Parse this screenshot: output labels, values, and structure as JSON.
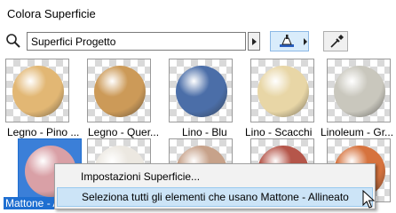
{
  "window": {
    "title": "Colora Superficie"
  },
  "toolbar": {
    "search_value": "Superfici Progetto",
    "icons": [
      "search-icon",
      "next-arrow-icon",
      "paint-brush-icon",
      "eyedropper-icon"
    ]
  },
  "surfaces": [
    {
      "label": "Legno - Pino ...",
      "color": "#e2b774",
      "selected": false
    },
    {
      "label": "Legno - Quer...",
      "color": "#cc9a58",
      "selected": false
    },
    {
      "label": "Lino - Blu",
      "color": "#4b6ea8",
      "selected": false
    },
    {
      "label": "Lino - Scacchi",
      "color": "#e8d6a6",
      "selected": false
    },
    {
      "label": "Linoleum - Gr...",
      "color": "#c9c7bd",
      "selected": false
    },
    {
      "label": "Mattone - Allineato",
      "color": "#d9a0a6",
      "selected": true
    },
    {
      "label": "",
      "color": "#ece8e1",
      "selected": false
    },
    {
      "label": "",
      "color": "#c7a28a",
      "selected": false
    },
    {
      "label": "",
      "color": "#b5564a",
      "selected": false
    },
    {
      "label": "",
      "color": "#d6733e",
      "selected": false
    }
  ],
  "context_menu": {
    "items": [
      "Impostazioni Superficie...",
      "Seleziona tutti gli elementi che usano Mattone - Allineato"
    ],
    "hovered_index": 1
  }
}
